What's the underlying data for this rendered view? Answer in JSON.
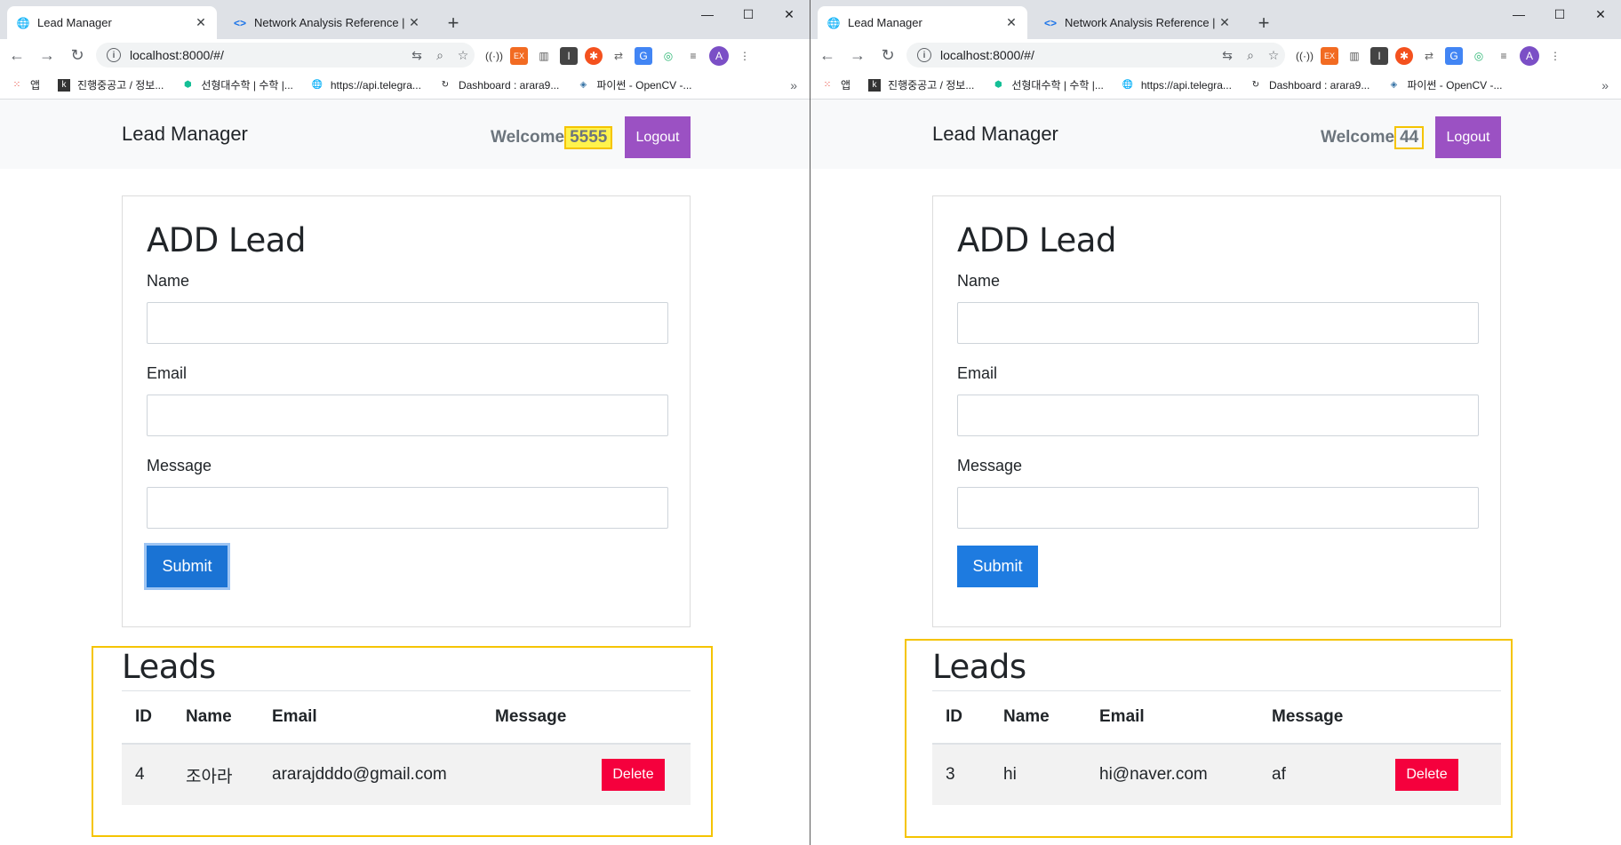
{
  "windows": [
    {
      "tabs": [
        {
          "title": "Lead Manager",
          "icon": "globe-icon"
        },
        {
          "title": "Network Analysis Reference |",
          "icon": "devtools-icon"
        }
      ],
      "toolbar": {
        "url": "localhost:8000/#/"
      },
      "bookmarks": [
        {
          "label": "앱",
          "icon": "apps-grid-icon"
        },
        {
          "label": "진행중공고 / 정보...",
          "icon": "k-logo-icon"
        },
        {
          "label": "선형대수학 | 수학 |...",
          "icon": "khan-icon"
        },
        {
          "label": "https://api.telegra...",
          "icon": "globe-icon"
        },
        {
          "label": "Dashboard : arara9...",
          "icon": "dashboard-icon"
        },
        {
          "label": "파이썬 - OpenCV -...",
          "icon": "python-icon"
        }
      ],
      "app": {
        "brand": "Lead Manager",
        "welcome_label": "Welcome",
        "username": "5555",
        "logout_label": "Logout",
        "form_title": "ADD Lead",
        "name_label": "Name",
        "email_label": "Email",
        "message_label": "Message",
        "submit_label": "Submit",
        "leads_title": "Leads",
        "columns": [
          "ID",
          "Name",
          "Email",
          "Message"
        ],
        "rows": [
          {
            "id": "4",
            "name": "조아라",
            "email": "ararajdddo@gmail.com",
            "message": "",
            "delete_label": "Delete"
          }
        ]
      }
    },
    {
      "tabs": [
        {
          "title": "Lead Manager",
          "icon": "globe-icon"
        },
        {
          "title": "Network Analysis Reference |",
          "icon": "devtools-icon"
        }
      ],
      "toolbar": {
        "url": "localhost:8000/#/"
      },
      "bookmarks": [
        {
          "label": "앱",
          "icon": "apps-grid-icon"
        },
        {
          "label": "진행중공고 / 정보...",
          "icon": "k-logo-icon"
        },
        {
          "label": "선형대수학 | 수학 |...",
          "icon": "khan-icon"
        },
        {
          "label": "https://api.telegra...",
          "icon": "globe-icon"
        },
        {
          "label": "Dashboard : arara9...",
          "icon": "dashboard-icon"
        },
        {
          "label": "파이썬 - OpenCV -...",
          "icon": "python-icon"
        }
      ],
      "app": {
        "brand": "Lead Manager",
        "welcome_label": "Welcome",
        "username": "44",
        "logout_label": "Logout",
        "form_title": "ADD Lead",
        "name_label": "Name",
        "email_label": "Email",
        "message_label": "Message",
        "submit_label": "Submit",
        "leads_title": "Leads",
        "columns": [
          "ID",
          "Name",
          "Email",
          "Message"
        ],
        "rows": [
          {
            "id": "3",
            "name": "hi",
            "email": "hi@naver.com",
            "message": "af",
            "delete_label": "Delete"
          }
        ]
      }
    }
  ],
  "colors": {
    "logout": "#9b51c3",
    "submit": "#1e7be0",
    "delete": "#f5003d",
    "highlight_border": "#f5c400",
    "username_highlight": "#fff34d"
  }
}
